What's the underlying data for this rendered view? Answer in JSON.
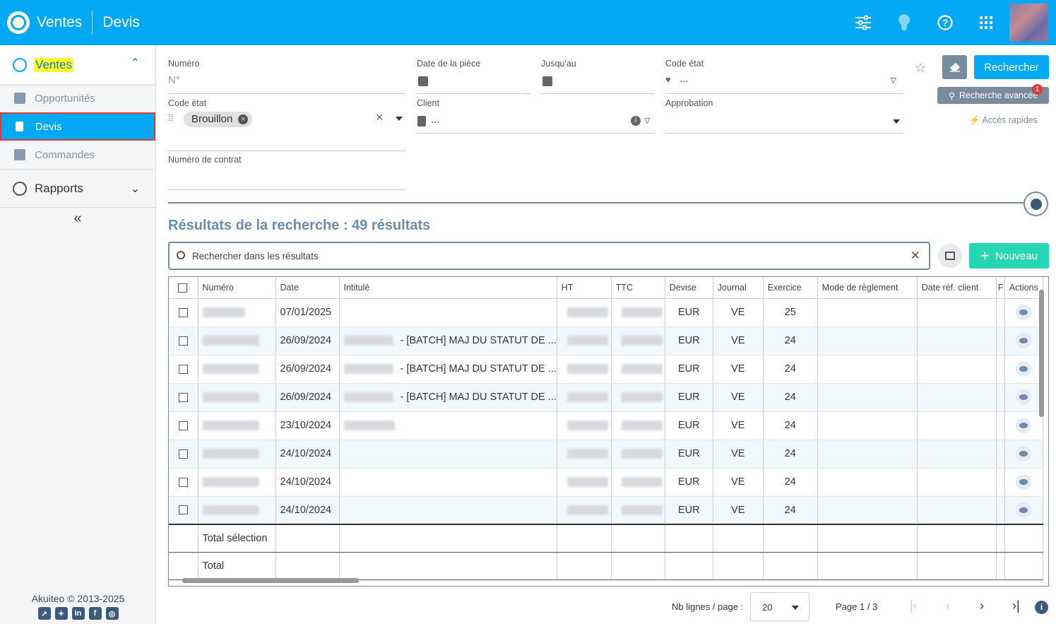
{
  "header": {
    "app_title": "Ventes",
    "page_title": "Devis"
  },
  "sidebar": {
    "section": "Ventes",
    "items": [
      {
        "label": "Opportunités",
        "active": false
      },
      {
        "label": "Devis",
        "active": true
      },
      {
        "label": "Commandes",
        "active": false
      }
    ],
    "reports": "Rapports",
    "collapse": "«",
    "footer": "Akuiteo © 2013-2025"
  },
  "filters": {
    "numero_label": "Numéro",
    "numero_placeholder": "N°",
    "date_label": "Date de la pièce",
    "until_label": "Jusqu'au",
    "code_etat_label": "Code état",
    "code_etat_value": "...",
    "code_etat2_label": "Code état",
    "code_etat2_chip": "Brouillon",
    "client_label": "Client",
    "client_value": "...",
    "approbation_label": "Approbation",
    "contrat_label": "Numéro de contrat"
  },
  "actions": {
    "search": "Rechercher",
    "advanced": "Recherche avancée",
    "advanced_badge": "1",
    "quick": "Accès rapides",
    "new": "Nouveau"
  },
  "results": {
    "title": "Résultats de la recherche : 49 résultats",
    "search_placeholder": "Rechercher dans les résultats"
  },
  "table": {
    "columns": [
      "Numéro",
      "Date",
      "Intitulé",
      "HT",
      "TTC",
      "Devise",
      "Journal",
      "Exercice",
      "Mode de règlement",
      "Date réf. client",
      "F",
      "Actions"
    ],
    "rows": [
      {
        "date": "07/01/2025",
        "intitule": "",
        "devise": "EUR",
        "journal": "VE",
        "exercice": "25"
      },
      {
        "date": "26/09/2024",
        "intitule": "- [BATCH] MAJ DU STATUT DE ...",
        "devise": "EUR",
        "journal": "VE",
        "exercice": "24"
      },
      {
        "date": "26/09/2024",
        "intitule": "- [BATCH] MAJ DU STATUT DE ...",
        "devise": "EUR",
        "journal": "VE",
        "exercice": "24"
      },
      {
        "date": "26/09/2024",
        "intitule": "- [BATCH] MAJ DU STATUT DE ...",
        "devise": "EUR",
        "journal": "VE",
        "exercice": "24"
      },
      {
        "date": "23/10/2024",
        "intitule": "",
        "devise": "EUR",
        "journal": "VE",
        "exercice": "24"
      },
      {
        "date": "24/10/2024",
        "intitule": "",
        "devise": "EUR",
        "journal": "VE",
        "exercice": "24"
      },
      {
        "date": "24/10/2024",
        "intitule": "",
        "devise": "EUR",
        "journal": "VE",
        "exercice": "24"
      },
      {
        "date": "24/10/2024",
        "intitule": "",
        "devise": "EUR",
        "journal": "VE",
        "exercice": "24"
      }
    ],
    "total_selection": "Total sélection",
    "total": "Total"
  },
  "pager": {
    "rows_label": "Nb lignes / page :",
    "rows_value": "20",
    "page_info": "Page 1 / 3"
  },
  "colors": {
    "primary": "#03A9F4",
    "secondary": "#7A8B9E",
    "new_button": "#26D7B3"
  }
}
